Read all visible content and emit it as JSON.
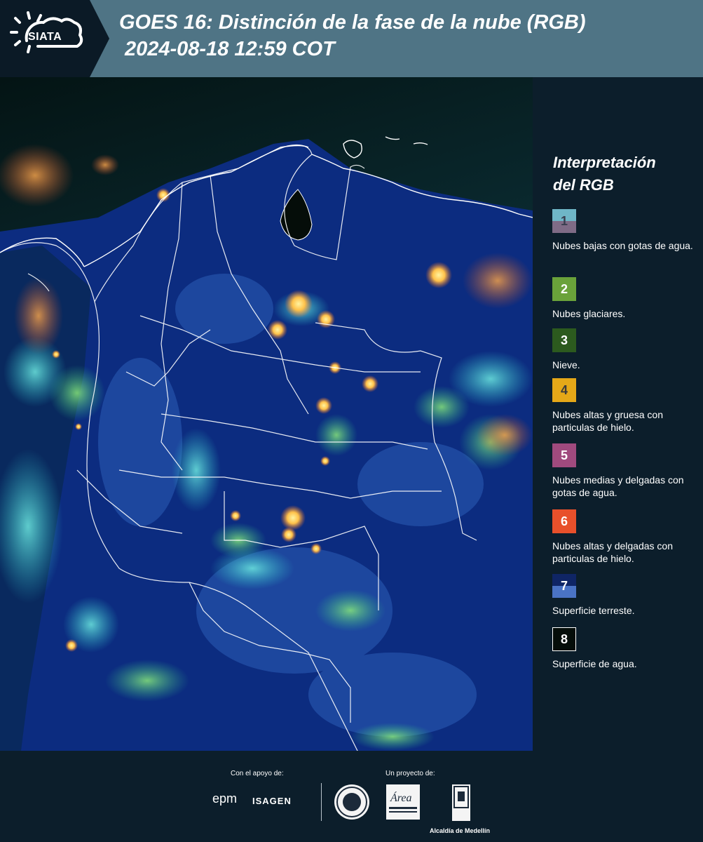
{
  "header": {
    "logo_text": "SIATA",
    "title": "GOES 16: Distinción de la fase de la nube (RGB)",
    "subtitle": "2024-08-18 12:59 COT"
  },
  "map": {
    "icon": "satellite-rgb-map-of-colombia"
  },
  "legend": {
    "title_line1": "Interpretación",
    "title_line2": "del RGB",
    "items": [
      {
        "number": "1",
        "label": "Nubes bajas con gotas de agua.",
        "color_top": "#6fb6c7",
        "color_bottom": "#7f6b86"
      },
      {
        "number": "2",
        "label": "Nubes glaciares.",
        "color_top": "#6aa23a",
        "color_bottom": "#6aa23a"
      },
      {
        "number": "3",
        "label": "Nieve.",
        "color_top": "#2c5a1e",
        "color_bottom": "#2c5a1e"
      },
      {
        "number": "4",
        "label": "Nubes altas y gruesa con particulas de hielo.",
        "color_top": "#e5a818",
        "color_bottom": "#e5a818"
      },
      {
        "number": "5",
        "label": "Nubes medias y delgadas con gotas de agua.",
        "color_top": "#a04a7e",
        "color_bottom": "#a04a7e"
      },
      {
        "number": "6",
        "label": "Nubes altas y delgadas con particulas de hielo.",
        "color_top": "#e8502b",
        "color_bottom": "#e8502b"
      },
      {
        "number": "7",
        "label": "Superficie terreste.",
        "color_top": "#0f2565",
        "color_bottom": "#4a73c5"
      },
      {
        "number": "8",
        "label": "Superficie de agua.",
        "color_top": "#050d09",
        "color_bottom": "#050d09"
      }
    ]
  },
  "footer": {
    "support_label": "Con el apoyo de:",
    "project_label": "Un proyecto de:",
    "sponsor1": "epm",
    "sponsor2": "ISAGEN",
    "partner_alcaldia": "Alcaldía de Medellín",
    "partner_area_text": "Área"
  }
}
